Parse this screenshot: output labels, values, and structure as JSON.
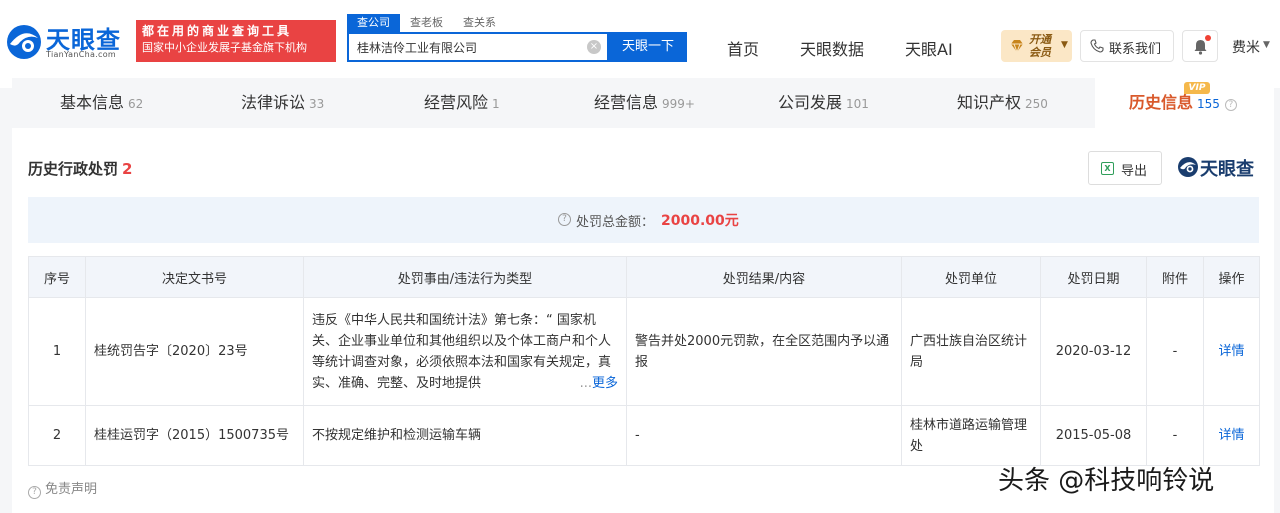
{
  "header": {
    "logo_text": "天眼查",
    "logo_sub": "TianYanCha.com",
    "slogan_line1": "都在用的商业查询工具",
    "slogan_line2": "国家中小企业发展子基金旗下机构",
    "search_tabs": [
      "查公司",
      "查老板",
      "查关系"
    ],
    "search_value": "桂林洁伶工业有限公司",
    "search_button": "天眼一下",
    "nav": [
      "首页",
      "天眼数据",
      "天眼AI"
    ],
    "vip_label": "开通会员",
    "contact_label": "联系我们",
    "user_name": "费米"
  },
  "tabs": [
    {
      "label": "基本信息",
      "count": "62"
    },
    {
      "label": "法律诉讼",
      "count": "33"
    },
    {
      "label": "经营风险",
      "count": "1"
    },
    {
      "label": "经营信息",
      "count": "999+"
    },
    {
      "label": "公司发展",
      "count": "101"
    },
    {
      "label": "知识产权",
      "count": "250"
    },
    {
      "label": "历史信息",
      "count": "155"
    }
  ],
  "vip_tag": "VIP",
  "section": {
    "title": "历史行政处罚",
    "count": "2",
    "export_label": "导出",
    "brand_text": "天眼查"
  },
  "total": {
    "label": "处罚总金额：",
    "value": "2000.00元"
  },
  "table": {
    "headers": [
      "序号",
      "决定文书号",
      "处罚事由/违法行为类型",
      "处罚结果/内容",
      "处罚单位",
      "处罚日期",
      "附件",
      "操作"
    ],
    "rows": [
      {
        "index": "1",
        "doc_no": "桂统罚告字〔2020〕23号",
        "reason": "违反《中华人民共和国统计法》第七条：“ 国家机关、企业事业单位和其他组织以及个体工商户和个人等统计调查对象，必须依照本法和国家有关规定，真实、准确、完整、及时地提供",
        "reason_more": "更多",
        "result": "警告并处2000元罚款，在全区范围内予以通报",
        "unit": "广西壮族自治区统计局",
        "date": "2020-03-12",
        "attachment": "-",
        "action": "详情"
      },
      {
        "index": "2",
        "doc_no": "桂桂运罚字（2015）1500735号",
        "reason": "不按规定维护和检测运输车辆",
        "result": "-",
        "unit": "桂林市道路运输管理处",
        "date": "2015-05-08",
        "attachment": "-",
        "action": "详情"
      }
    ]
  },
  "disclaimer": "免责声明",
  "watermark": "头条 @科技响铃说",
  "colors": {
    "brand_blue": "#0a66d8",
    "slogan_red": "#e94343",
    "active_tab": "#d9592b",
    "penalty_red": "#e94343"
  }
}
